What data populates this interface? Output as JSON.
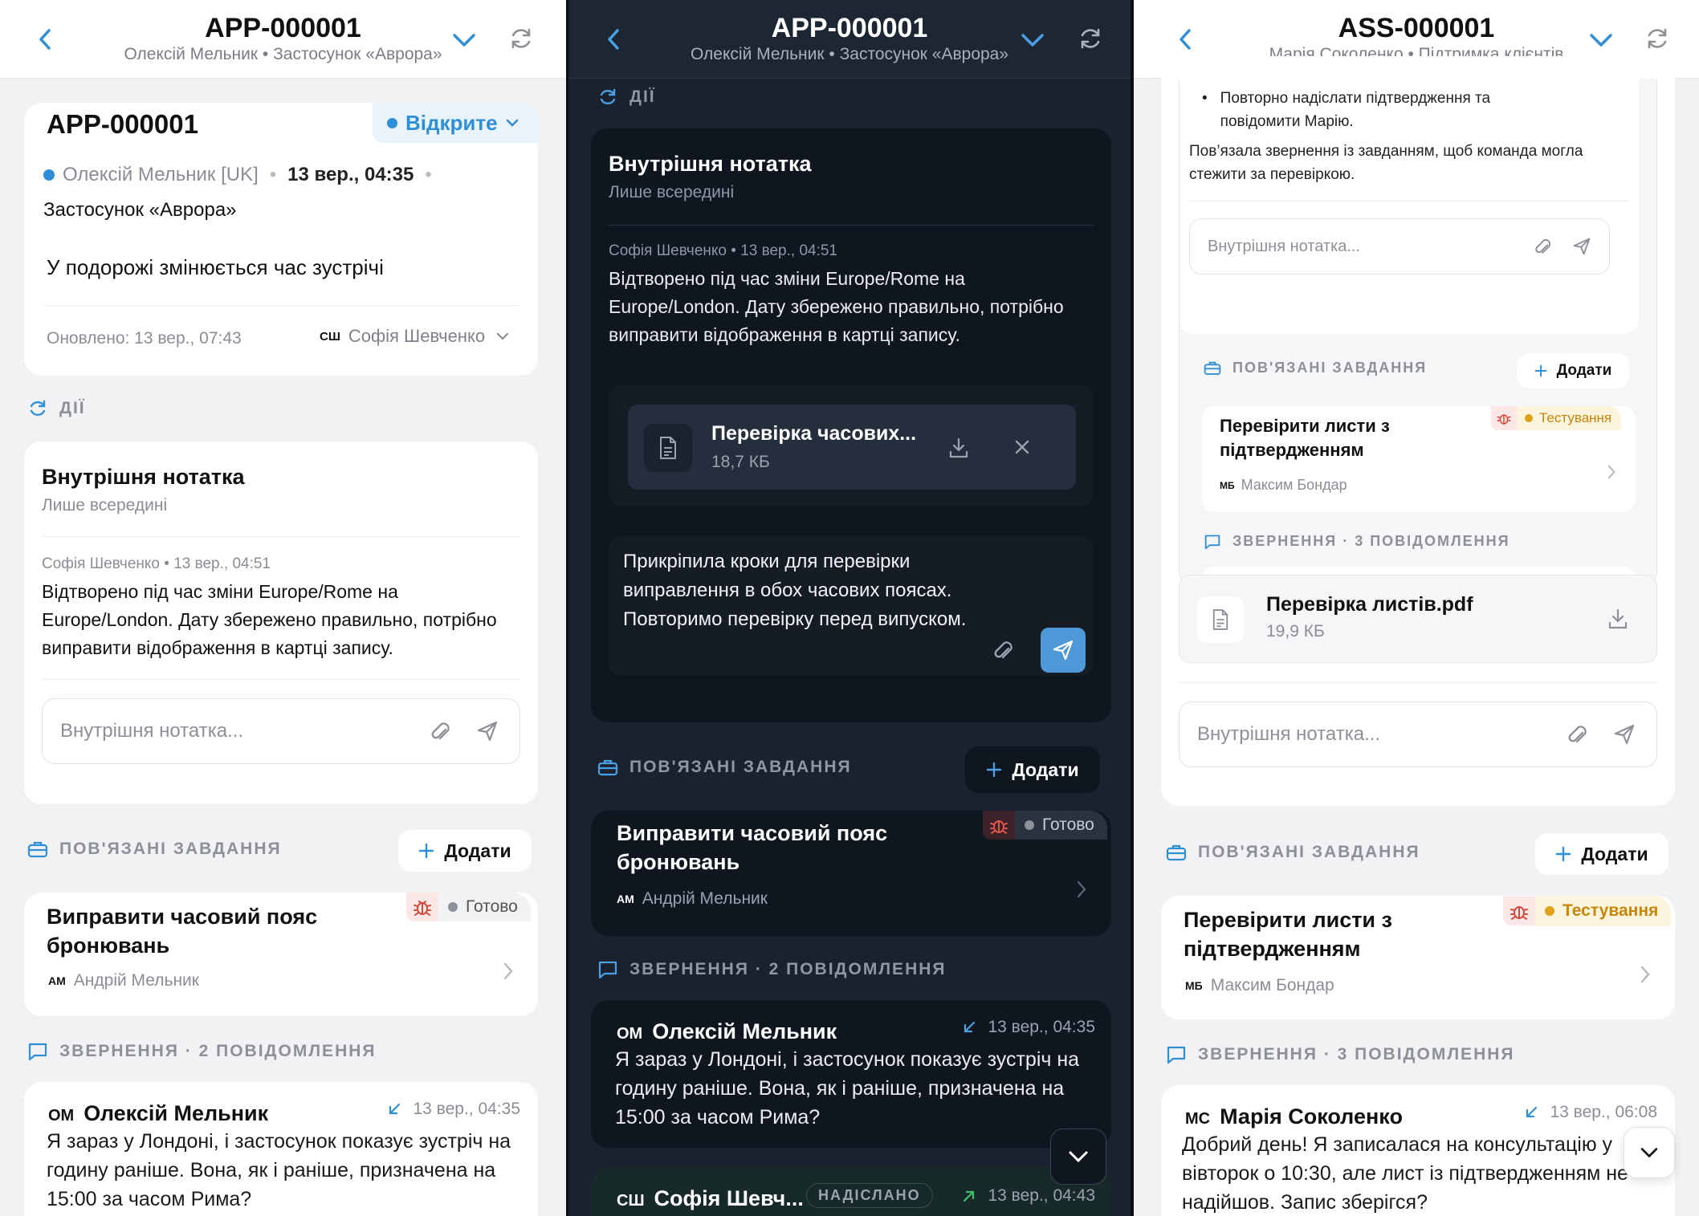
{
  "p1": {
    "header": {
      "title": "APP-000001",
      "subtitle": "Олексій Мельник • Застосунок «Аврора»"
    },
    "ticket": {
      "id": "APP-000001",
      "status": "Відкрите",
      "customer": "Олексій Мельник [UK]",
      "date": "13 вер., 04:35",
      "product": "Застосунок «Аврора»",
      "subject": "У подорожі змінюється час зустрічі",
      "updated": "Оновлено: 13 вер., 07:43",
      "assignee_initials": "СШ",
      "assignee": "Софія Шевченко"
    },
    "actions_label": "ДІЇ",
    "note": {
      "title": "Внутрішня нотатка",
      "subtitle": "Лише всередині",
      "meta": "Софія Шевченко • 13 вер., 04:51",
      "text": "Відтворено під час зміни Europe/Rome на Europe/London. Дату збережено правильно, потрібно виправити відображення в картці запису.",
      "placeholder": "Внутрішня нотатка..."
    },
    "tasks_label": "ПОВ'ЯЗАНІ ЗАВДАННЯ",
    "add_label": "Додати",
    "task": {
      "title": "Виправити часовий пояс бронювань",
      "status": "Готово",
      "assignee_initials": "АМ",
      "assignee": "Андрій Мельник"
    },
    "conv_label": "ЗВЕРНЕННЯ · 2 ПОВІДОМЛЕННЯ",
    "message": {
      "initials": "ОМ",
      "name": "Олексій Мельник",
      "time": "13 вер., 04:35",
      "text": "Я зараз у Лондоні, і застосунок показує зустріч на годину раніше. Вона, як і раніше, призначена на 15:00 за часом Рима?"
    }
  },
  "p2": {
    "header": {
      "title": "APP-000001",
      "subtitle": "Олексій Мельник • Застосунок «Аврора»"
    },
    "actions_label": "ДІЇ",
    "note": {
      "title": "Внутрішня нотатка",
      "subtitle": "Лише всередині",
      "meta": "Софія Шевченко • 13 вер., 04:51",
      "text": "Відтворено під час зміни Europe/Rome на Europe/London. Дату збережено правильно, потрібно виправити відображення в картці запису."
    },
    "attachment": {
      "name": "Перевірка часових...",
      "size": "18,7 КБ"
    },
    "draft": "Прикріпила кроки для перевірки виправлення в обох часових поясах. Повторимо перевірку перед випуском.",
    "tasks_label": "ПОВ'ЯЗАНІ ЗАВДАННЯ",
    "add_label": "Додати",
    "task": {
      "title": "Виправити часовий пояс бронювань",
      "status": "Готово",
      "assignee_initials": "АМ",
      "assignee": "Андрій Мельник"
    },
    "conv_label": "ЗВЕРНЕННЯ · 2 ПОВІДОМЛЕННЯ",
    "message": {
      "initials": "ОМ",
      "name": "Олексій Мельник",
      "time": "13 вер., 04:35",
      "text": "Я зараз у Лондоні, і застосунок показує зустріч на годину раніше. Вона, як і раніше, призначена на 15:00 за часом Рима?"
    },
    "message2": {
      "initials": "СШ",
      "name": "Софія Шевч...",
      "badge": "НАДІСЛАНО",
      "time": "13 вер., 04:43"
    }
  },
  "p3": {
    "header": {
      "title": "ASS-000001",
      "subtitle": "Марія Соколенко • Підтримка клієнтів"
    },
    "note_bullet": "Повторно надіслати підтвердження та повідомити Марію.",
    "note_text": "Пов’язала звернення із завданням, щоб команда могла стежити за перевіркою.",
    "placeholder": "Внутрішня нотатка...",
    "tasks_label": "ПОВ'ЯЗАНІ ЗАВДАННЯ",
    "add_label": "Додати",
    "task": {
      "title": "Перевірити листи з підтвердженням",
      "status": "Тестування",
      "assignee_initials": "МБ",
      "assignee": "Максим Бондар"
    },
    "conv_label": "ЗВЕРНЕННЯ · 3 ПОВІДОМЛЕННЯ",
    "attachment": {
      "name": "Перевірка листів.pdf",
      "size": "19,9 КБ"
    },
    "message": {
      "initials": "МС",
      "name": "Марія Соколенко",
      "time": "13 вер., 06:08",
      "text": "Добрий день! Я записалася на консультацію у вівторок о 10:30, але лист із підтвердженням не надійшов. Запис зберігся?"
    }
  },
  "colors": {
    "accent": "#2f8fd6",
    "done": "#8d9198",
    "testing": "#e0a11b",
    "bug_red": "#d44a3a"
  }
}
